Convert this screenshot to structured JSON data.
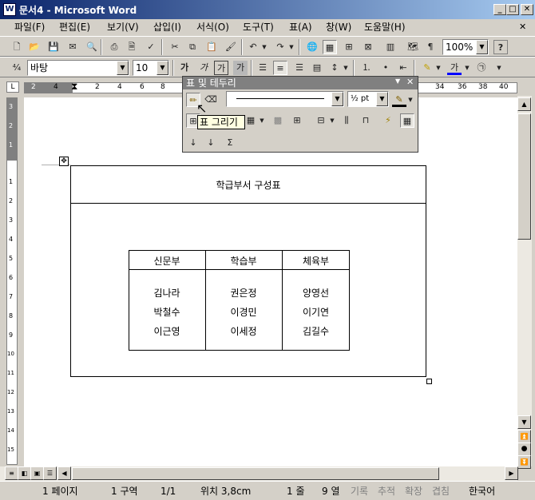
{
  "window": {
    "title": "문서4 - Microsoft Word",
    "minimize": "_",
    "maximize": "□",
    "close": "✕"
  },
  "menu": [
    "파일(F)",
    "편집(E)",
    "보기(V)",
    "삽입(I)",
    "서식(O)",
    "도구(T)",
    "표(A)",
    "창(W)",
    "도움말(H)"
  ],
  "toolbar": {
    "zoom": "100%",
    "help": "?"
  },
  "format": {
    "style": "바탕",
    "font_size": "10",
    "bold": "가",
    "italic": "가",
    "underline": "가",
    "char_shade": "가",
    "highlight": "가"
  },
  "ruler": {
    "ticks": [
      "4",
      "2",
      "2",
      "4",
      "6",
      "8",
      "34",
      "36",
      "38",
      "40"
    ]
  },
  "vruler": {
    "ticks": [
      "3",
      "2",
      "1",
      "1",
      "2",
      "3",
      "4",
      "5",
      "6",
      "7",
      "8",
      "9",
      "10",
      "11",
      "12",
      "13",
      "14",
      "15"
    ]
  },
  "tables_panel": {
    "title": "표 및 테두리",
    "line_weight": "½ pt",
    "tooltip": "표 그리기"
  },
  "document": {
    "title": "학급부서 구성표",
    "headers": [
      "신문부",
      "학습부",
      "체육부"
    ],
    "columns": [
      [
        "김나라",
        "박철수",
        "이근영"
      ],
      [
        "권은정",
        "이경민",
        "이세정"
      ],
      [
        "양영선",
        "이기연",
        "김길수"
      ]
    ]
  },
  "status": {
    "page": "1 페이지",
    "section": "1 구역",
    "pages": "1/1",
    "position": "위치 3,8cm",
    "line": "1 줄",
    "col": "9 열",
    "rec": "기록",
    "trk": "추적",
    "ext": "확장",
    "ovr": "겹침",
    "lang": "한국어"
  }
}
